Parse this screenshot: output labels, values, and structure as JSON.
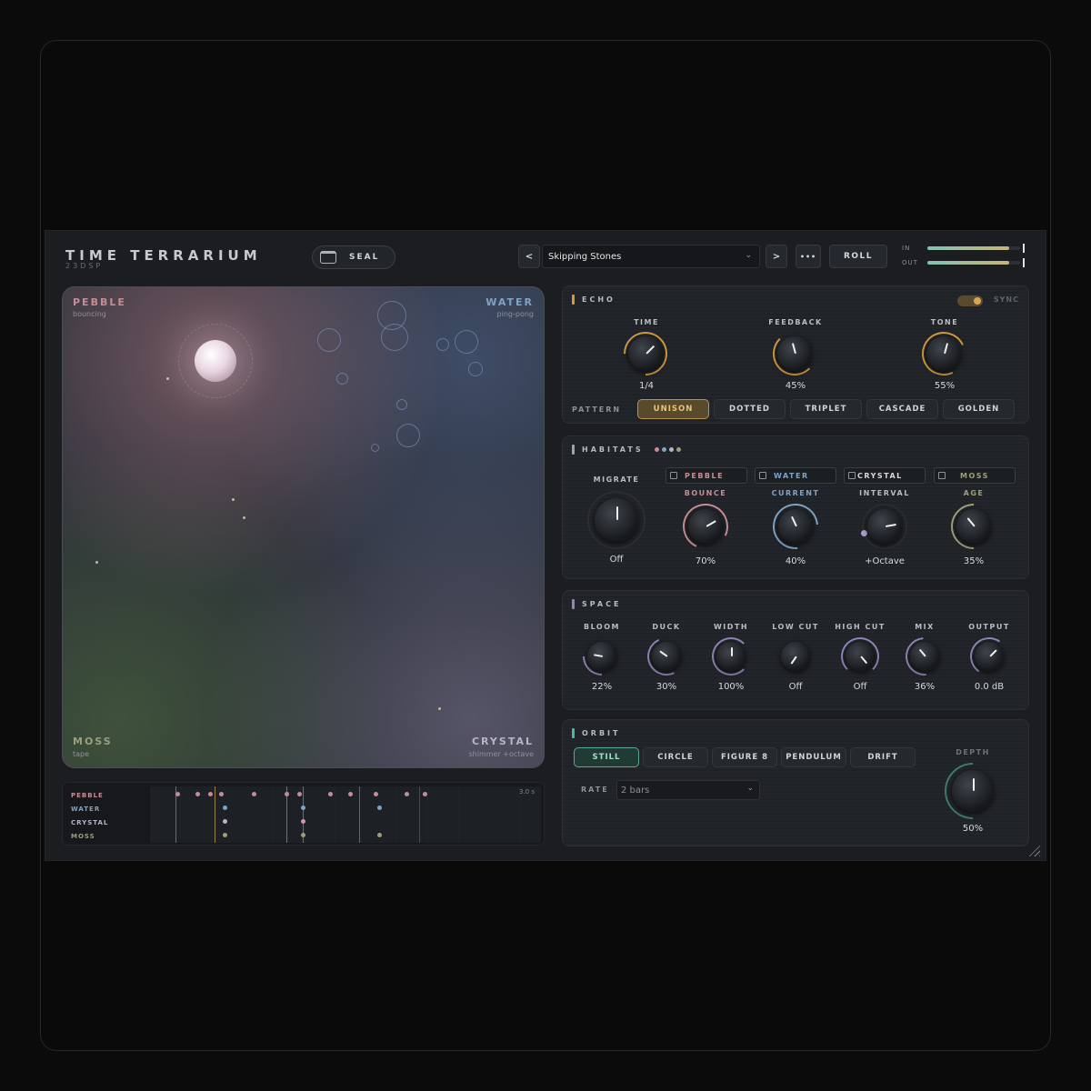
{
  "brand": {
    "title": "TIME TERRARIUM",
    "subtitle": "23DSP"
  },
  "header": {
    "seal_label": "SEAL",
    "prev": "<",
    "next": ">",
    "more": "•••",
    "preset": "Skipping Stones",
    "roll": "ROLL",
    "meters": [
      {
        "label": "IN",
        "level": 0.88
      },
      {
        "label": "OUT",
        "level": 0.88
      }
    ]
  },
  "terrarium": {
    "pebble": {
      "name": "PEBBLE",
      "mode": "bouncing",
      "color": "#c98c96"
    },
    "water": {
      "name": "WATER",
      "mode": "ping-pong",
      "color": "#7ea3c4"
    },
    "moss": {
      "name": "MOSS",
      "mode": "tape",
      "color": "#9aa07a"
    },
    "crystal": {
      "name": "CRYSTAL",
      "mode": "shimmer +octave",
      "color": "#b8b4c6"
    }
  },
  "timeline": {
    "duration": "3.0 s",
    "tracks": [
      {
        "label": "PEBBLE",
        "color": "#c98c96"
      },
      {
        "label": "WATER",
        "color": "#7ea3c4"
      },
      {
        "label": "CRYSTAL",
        "color": "#b8b4c6"
      },
      {
        "label": "MOSS",
        "color": "#9aa07a"
      }
    ]
  },
  "echo": {
    "title": "ECHO",
    "sync": "SYNC",
    "knobs": [
      {
        "label": "TIME",
        "value": "1/4"
      },
      {
        "label": "FEEDBACK",
        "value": "45%"
      },
      {
        "label": "TONE",
        "value": "55%"
      }
    ],
    "pattern_label": "PATTERN",
    "patterns": [
      "UNISON",
      "DOTTED",
      "TRIPLET",
      "CASCADE",
      "GOLDEN"
    ]
  },
  "habitats": {
    "title": "HABITATS",
    "migrate": {
      "label": "MIGRATE",
      "value": "Off"
    },
    "tabs": [
      "PEBBLE",
      "WATER",
      "CRYSTAL",
      "MOSS"
    ],
    "knobs": [
      {
        "label": "BOUNCE",
        "value": "70%"
      },
      {
        "label": "CURRENT",
        "value": "40%"
      },
      {
        "label": "INTERVAL",
        "value": "+Octave"
      },
      {
        "label": "AGE",
        "value": "35%"
      }
    ]
  },
  "space": {
    "title": "SPACE",
    "knobs": [
      {
        "label": "BLOOM",
        "value": "22%"
      },
      {
        "label": "DUCK",
        "value": "30%"
      },
      {
        "label": "WIDTH",
        "value": "100%"
      },
      {
        "label": "LOW CUT",
        "value": "Off"
      },
      {
        "label": "HIGH CUT",
        "value": "Off"
      },
      {
        "label": "MIX",
        "value": "36%"
      },
      {
        "label": "OUTPUT",
        "value": "0.0 dB"
      }
    ]
  },
  "orbit": {
    "title": "ORBIT",
    "modes": [
      "STILL",
      "CIRCLE",
      "FIGURE 8",
      "PENDULUM",
      "DRIFT"
    ],
    "rate_label": "RATE",
    "rate_value": "2 bars",
    "depth": {
      "label": "DEPTH",
      "value": "50%"
    }
  },
  "colors": {
    "echo": "#d19a3e",
    "habitats": "#9ea3a8",
    "space": "#8e86b8",
    "orbit": "#4fb59c",
    "pebble": "#c98c96",
    "water": "#7ea3c4",
    "crystal": "#b8b4c6",
    "moss": "#9aa07a"
  }
}
